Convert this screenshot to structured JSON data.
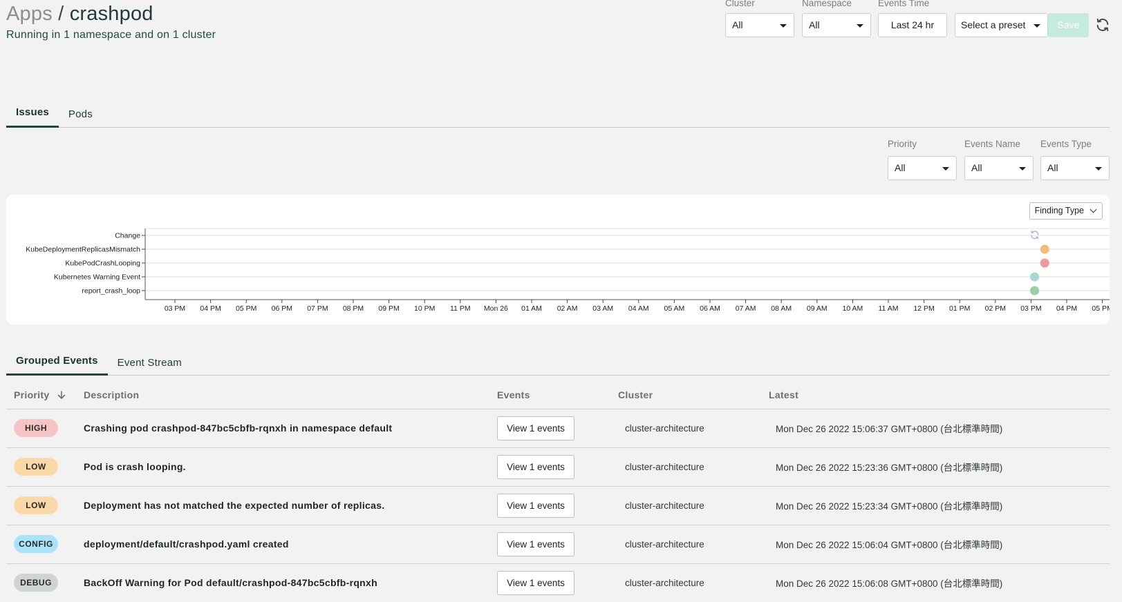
{
  "header": {
    "breadcrumb_root": "Apps",
    "separator": "/",
    "app_name": "crashpod",
    "subtitle": "Running in 1 namespace and on 1 cluster"
  },
  "filters": {
    "cluster": {
      "label": "Cluster",
      "value": "All"
    },
    "namespace": {
      "label": "Namespace",
      "value": "All"
    },
    "events_time": {
      "label": "Events Time",
      "value": "Last 24 hr"
    },
    "preset": {
      "value": "Select a preset"
    },
    "save_label": "Save",
    "refresh_icon": "refresh-icon"
  },
  "main_tabs": [
    {
      "label": "Issues",
      "active": true
    },
    {
      "label": "Pods",
      "active": false
    }
  ],
  "issue_filters": {
    "priority": {
      "label": "Priority",
      "value": "All"
    },
    "events_name": {
      "label": "Events Name",
      "value": "All"
    },
    "events_type": {
      "label": "Events Type",
      "value": "All"
    }
  },
  "chart_data": {
    "type": "scatter",
    "group_by_label": "Finding Type",
    "categories": [
      "Change",
      "KubeDeploymentReplicasMismatch",
      "KubePodCrashLooping",
      "Kubernetes Warning Event",
      "report_crash_loop"
    ],
    "x_ticks": [
      "03 PM",
      "04 PM",
      "05 PM",
      "06 PM",
      "07 PM",
      "08 PM",
      "09 PM",
      "10 PM",
      "11 PM",
      "Mon 26",
      "01 AM",
      "02 AM",
      "03 AM",
      "04 AM",
      "05 AM",
      "06 AM",
      "07 AM",
      "08 AM",
      "09 AM",
      "10 AM",
      "11 AM",
      "12 PM",
      "01 PM",
      "02 PM",
      "03 PM",
      "04 PM",
      "05 PM"
    ],
    "points": [
      {
        "category": "Change",
        "time": "Mon Dec 26 15:06",
        "marker": "refresh-icon",
        "color": "#a9b8de"
      },
      {
        "category": "KubeDeploymentReplicasMismatch",
        "time": "Mon Dec 26 15:23",
        "color": "#f5b97a"
      },
      {
        "category": "KubePodCrashLooping",
        "time": "Mon Dec 26 15:23",
        "color": "#f09a9c"
      },
      {
        "category": "Kubernetes Warning Event",
        "time": "Mon Dec 26 15:06",
        "color": "#a8d9d0"
      },
      {
        "category": "report_crash_loop",
        "time": "Mon Dec 26 15:06",
        "color": "#99cfa3"
      }
    ],
    "grid": true
  },
  "event_tabs": [
    {
      "label": "Grouped Events",
      "active": true
    },
    {
      "label": "Event Stream",
      "active": false
    }
  ],
  "table": {
    "headers": [
      "Priority",
      "Description",
      "Events",
      "Cluster",
      "Latest"
    ],
    "sort_icon": "arrow-down-icon",
    "rows": [
      {
        "priority": "HIGH",
        "badge_color": "#f7c4c6",
        "description": "Crashing pod crashpod-847bc5cbfb-rqnxh in namespace default",
        "events": "View 1 events",
        "cluster": "cluster-architecture",
        "latest": "Mon Dec 26 2022 15:06:37 GMT+0800 (台北標準時間)"
      },
      {
        "priority": "LOW",
        "badge_color": "#fad9a8",
        "description": "Pod is crash looping.",
        "events": "View 1 events",
        "cluster": "cluster-architecture",
        "latest": "Mon Dec 26 2022 15:23:36 GMT+0800 (台北標準時間)"
      },
      {
        "priority": "LOW",
        "badge_color": "#fad9a8",
        "description": "Deployment has not matched the expected number of replicas.",
        "events": "View 1 events",
        "cluster": "cluster-architecture",
        "latest": "Mon Dec 26 2022 15:23:34 GMT+0800 (台北標準時間)"
      },
      {
        "priority": "CONFIG",
        "badge_color": "#a9e3f8",
        "description": "deployment/default/crashpod.yaml created",
        "events": "View 1 events",
        "cluster": "cluster-architecture",
        "latest": "Mon Dec 26 2022 15:06:04 GMT+0800 (台北標準時間)"
      },
      {
        "priority": "DEBUG",
        "badge_color": "#cfd3d3",
        "description": "BackOff Warning for Pod default/crashpod-847bc5cbfb-rqnxh",
        "events": "View 1 events",
        "cluster": "cluster-architecture",
        "latest": "Mon Dec 26 2022 15:06:08 GMT+0800 (台北標準時間)"
      }
    ]
  }
}
